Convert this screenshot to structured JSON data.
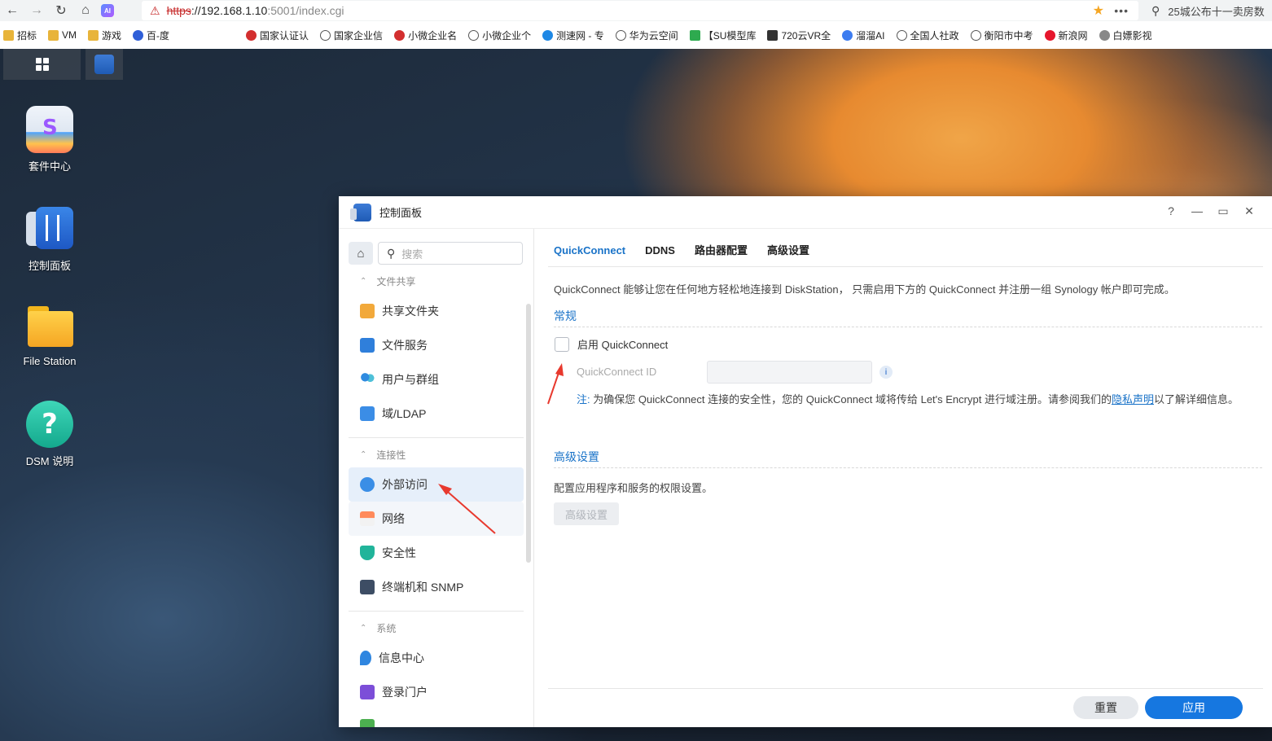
{
  "browser": {
    "url_protocol": "https",
    "url_host": "://192.168.1.10",
    "url_rest": ":5001/index.cgi",
    "search_text": "25城公布十一卖房数",
    "ai_badge": "AI",
    "bookmarks": [
      {
        "label": "招标",
        "icon": "folder-icon"
      },
      {
        "label": "VM",
        "icon": "folder-icon"
      },
      {
        "label": "游戏",
        "icon": "folder-icon"
      },
      {
        "label": "百-度",
        "icon": "baidu-icon"
      },
      {
        "label": "国家认证认",
        "icon": "emblem-icon"
      },
      {
        "label": "国家企业信",
        "icon": "globe-icon"
      },
      {
        "label": "小微企业名",
        "icon": "emblem-icon"
      },
      {
        "label": "小微企业个",
        "icon": "globe-icon"
      },
      {
        "label": "测速网 - 专",
        "icon": "speed-icon"
      },
      {
        "label": "华为云空间",
        "icon": "globe-icon"
      },
      {
        "label": "【SU模型库",
        "icon": "su-icon"
      },
      {
        "label": "720云VR全",
        "icon": "720-icon"
      },
      {
        "label": "溜溜AI",
        "icon": "ai-icon"
      },
      {
        "label": "全国人社政",
        "icon": "globe-icon"
      },
      {
        "label": "衡阳市中考",
        "icon": "globe-icon"
      },
      {
        "label": "新浪网",
        "icon": "weibo-icon"
      },
      {
        "label": "白嫖影视",
        "icon": "film-icon"
      }
    ]
  },
  "desktop": {
    "icons": [
      {
        "label": "套件中心",
        "icon": "package-center-icon"
      },
      {
        "label": "控制面板",
        "icon": "control-panel-icon"
      },
      {
        "label": "File Station",
        "icon": "file-station-icon"
      },
      {
        "label": "DSM 说明",
        "icon": "help-icon"
      }
    ]
  },
  "window": {
    "title": "控制面板",
    "controls": {
      "help": "?",
      "minimize": "—",
      "maximize": "▭",
      "close": "✕"
    }
  },
  "sidebar": {
    "search_placeholder": "搜索",
    "sections": {
      "file_sharing": "文件共享",
      "connectivity": "连接性",
      "system": "系统"
    },
    "items": {
      "shared_folder": "共享文件夹",
      "file_services": "文件服务",
      "user_group": "用户与群组",
      "domain_ldap": "域/LDAP",
      "external_access": "外部访问",
      "network": "网络",
      "security": "安全性",
      "terminal_snmp": "终端机和 SNMP",
      "info_center": "信息中心",
      "login_portal": "登录门户"
    }
  },
  "content": {
    "tabs": [
      "QuickConnect",
      "DDNS",
      "路由器配置",
      "高级设置"
    ],
    "active_tab": "QuickConnect",
    "intro": "QuickConnect 能够让您在任何地方轻松地连接到 DiskStation， 只需启用下方的 QuickConnect 并注册一组 Synology 帐户即可完成。",
    "general_header": "常规",
    "enable_label": "启用 QuickConnect",
    "enable_checked": false,
    "qc_id_label": "QuickConnect ID",
    "qc_id_value": "",
    "note_prefix": "注:",
    "note_text": " 为确保您 QuickConnect 连接的安全性，您的 QuickConnect 域将传给 Let's Encrypt 进行域注册。请参阅我们的",
    "note_link": "隐私声明",
    "note_suffix": "以了解详细信息。",
    "advanced_header": "高级设置",
    "advanced_desc": "配置应用程序和服务的权限设置。",
    "advanced_button": "高级设置",
    "reset_button": "重置",
    "apply_button": "应用"
  },
  "colors": {
    "accent": "#1a73c8",
    "apply": "#1677e0",
    "annotation_arrow": "#e8392e"
  }
}
